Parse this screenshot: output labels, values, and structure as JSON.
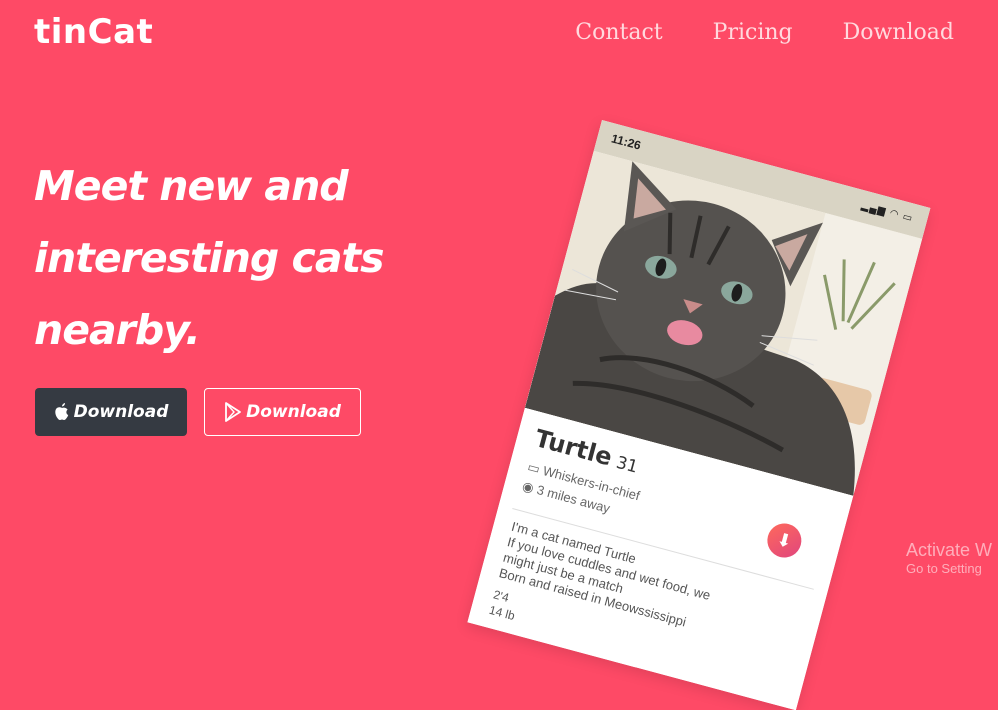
{
  "brand": "tinCat",
  "nav": [
    "Contact",
    "Pricing",
    "Download"
  ],
  "hero": {
    "line1": "Meet new and",
    "line2": "interesting cats",
    "line3": "nearby."
  },
  "buttons": {
    "apple_label": "Download",
    "play_label": "Download"
  },
  "phone": {
    "time": "11:26",
    "profile": {
      "name": "Turtle",
      "age": "31",
      "job": "Whiskers-in-chief",
      "distance": "3 miles away",
      "bio": [
        "I'm a cat named Turtle",
        "If you love cuddles and wet food, we",
        "might just be a match",
        "Born and raised in Meowssissippi"
      ],
      "height": "2'4",
      "weight": "14 lb"
    }
  },
  "watermark": {
    "title": "Activate W",
    "subtitle": "Go to Setting"
  },
  "colors": {
    "background": "#fe4a66",
    "apple_button": "#353a42",
    "nav_text": "#ffd9de"
  }
}
